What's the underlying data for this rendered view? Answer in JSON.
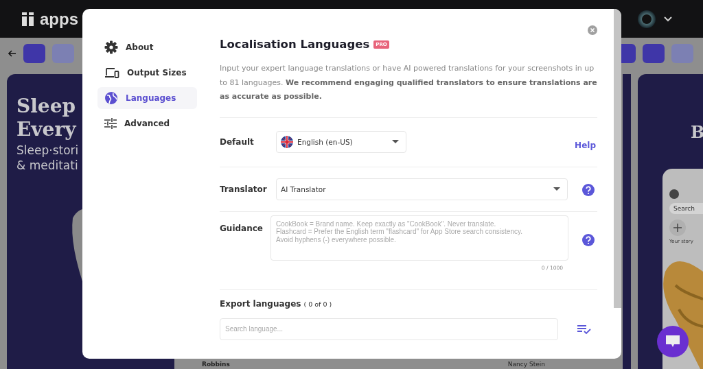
{
  "app": {
    "logo": "apps"
  },
  "background": {
    "headline": [
      "Sleep",
      "Every"
    ],
    "subtitle": [
      "Sleep·stori",
      "& meditati"
    ],
    "right_headline": "B",
    "search": "Search",
    "story_label": "Your story",
    "bottom_labels": [
      "Robbins",
      "Nancy Stein"
    ]
  },
  "modal": {
    "nav": [
      {
        "label": "About",
        "selected": false
      },
      {
        "label": "Output Sizes",
        "selected": false
      },
      {
        "label": "Languages",
        "selected": true
      },
      {
        "label": "Advanced",
        "selected": false
      }
    ],
    "title": "Localisation Languages",
    "badge": "PRO",
    "description": "Input your expert language translations or have AI powered translations for your screenshots in up to 81 languages. **We recommend engaging qualified translators to ensure translations are as accurate as possible.**",
    "default": {
      "label": "Default",
      "value": "English (en-US)",
      "help": "Help"
    },
    "translator": {
      "label": "Translator",
      "value": "AI Translator"
    },
    "guidance": {
      "label": "Guidance",
      "placeholder": "CookBook = Brand name. Keep exactly as \"CookBook\". Never translate.\nFlashcard = Prefer the English term \"flashcard\" for App Store search consistency.\nAvoid hyphens (-) everywhere possible.",
      "counter": "0 / 1000"
    },
    "export": {
      "label": "Export languages",
      "count": "( 0 of 0 )",
      "search_placeholder": "Search language..."
    }
  }
}
